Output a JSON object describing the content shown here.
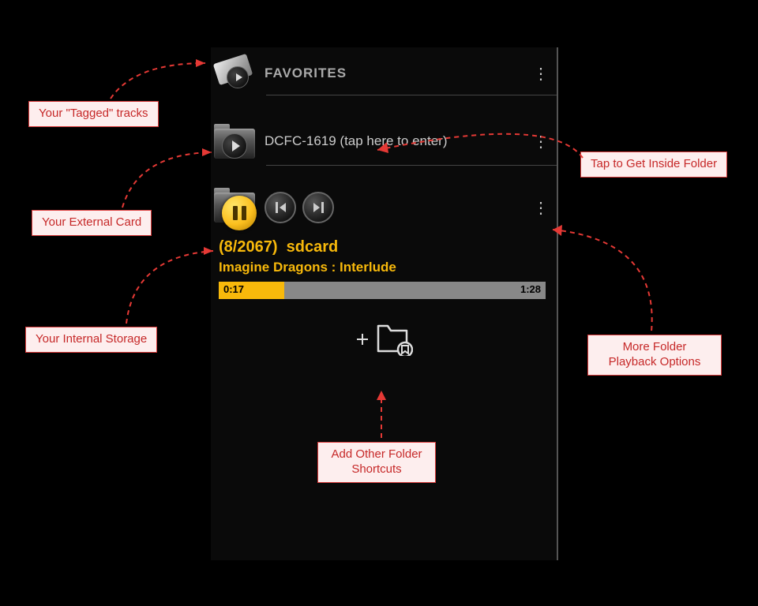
{
  "rows": {
    "favorites": {
      "label": "FAVORITES"
    },
    "folder1": {
      "label": "DCFC-1619 (tap here to enter)"
    }
  },
  "playing": {
    "count": "(8/2067)",
    "folder": "sdcard",
    "track": "Imagine Dragons : Interlude",
    "current": "0:17",
    "total": "1:28",
    "progress_pct": 20
  },
  "annotations": {
    "tagged": "Your \"Tagged\" tracks",
    "external": "Your External Card",
    "internal": "Your Internal Storage",
    "inside": "Tap to Get Inside Folder",
    "options": "More Folder Playback Options",
    "addshort": "Add Other Folder Shortcuts"
  }
}
